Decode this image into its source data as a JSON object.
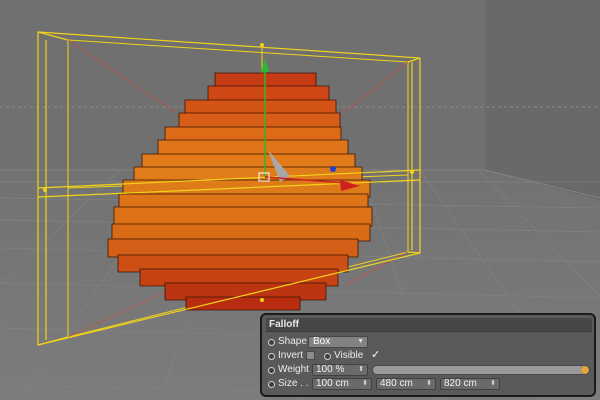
{
  "falloff_panel": {
    "title": "Falloff",
    "shape_label": "Shape",
    "shape_value": "Box",
    "invert_label": "Invert",
    "invert_checked": false,
    "visible_label": "Visible",
    "visible_checked": true,
    "visible_check_glyph": "✓",
    "weight_label": "Weight",
    "weight_value": "100 %",
    "weight_fraction": 1.0,
    "size_label": "Size . .",
    "size_x": "100 cm",
    "size_y": "480 cm",
    "size_z": "820 cm"
  },
  "colors": {
    "viewport_background": "#6f6f6f",
    "grid_floor": "#7a7a7a",
    "falloff_box": "#f2d31b",
    "bricks_top": "#c63a14",
    "bricks_mid": "#dd7417",
    "bricks_bottom": "#b82d10",
    "axis_y": "#2db82d",
    "axis_x": "#d02020",
    "axis_z": "#2040d0",
    "slider_knob": "#e4a43a"
  },
  "icons": {
    "dropdown": "chevron-down-icon",
    "spinner": "spinner-arrows-icon",
    "axis_gizmo": "move-gizmo-icon"
  }
}
